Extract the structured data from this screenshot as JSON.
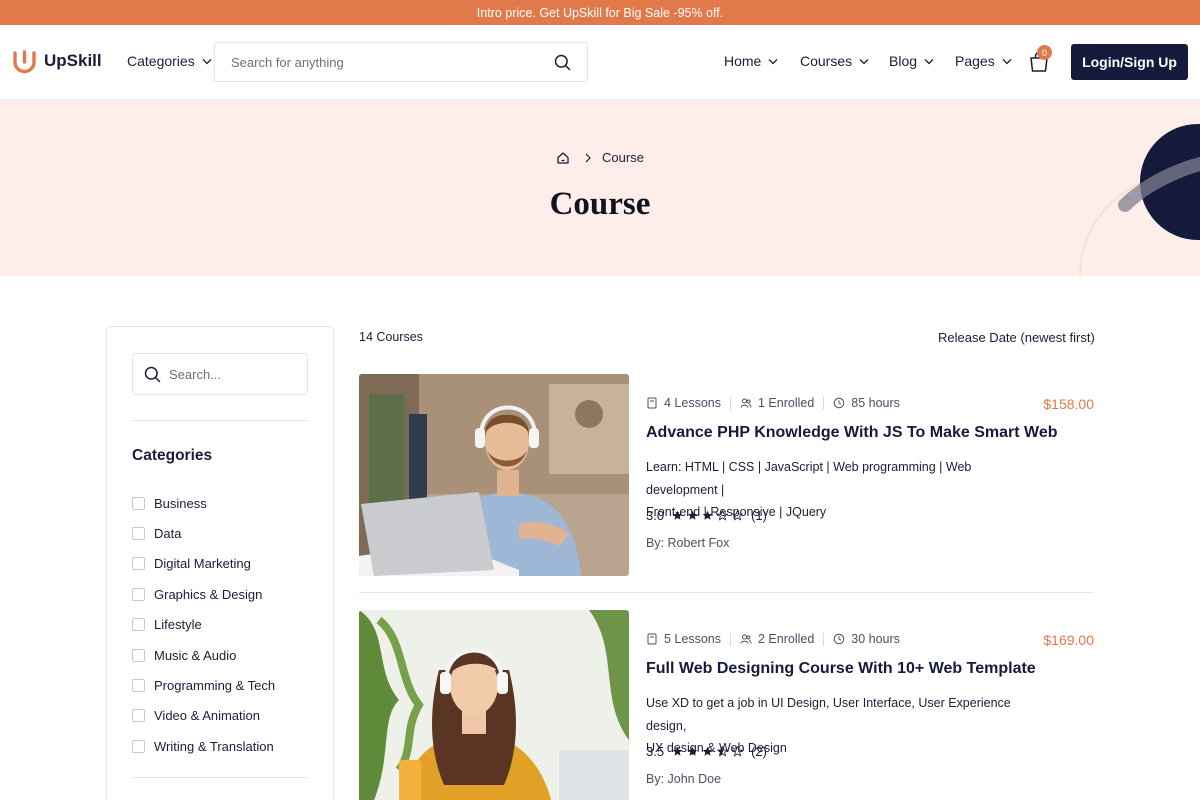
{
  "promo": {
    "text": "Intro price. Get UpSkill for Big Sale -95% off."
  },
  "header": {
    "brand": "UpSkill",
    "categories_label": "Categories",
    "search_placeholder": "Search for anything",
    "nav": [
      {
        "label": "Home"
      },
      {
        "label": "Courses"
      },
      {
        "label": "Blog"
      },
      {
        "label": "Pages"
      }
    ],
    "cart_count": "0",
    "login_label": "Login/Sign Up"
  },
  "hero": {
    "breadcrumb_current": "Course",
    "title": "Course"
  },
  "sidebar": {
    "search_placeholder": "Search...",
    "categories_title": "Categories",
    "categories": [
      {
        "label": "Business"
      },
      {
        "label": "Data"
      },
      {
        "label": "Digital Marketing"
      },
      {
        "label": "Graphics & Design"
      },
      {
        "label": "Lifestyle"
      },
      {
        "label": "Music & Audio"
      },
      {
        "label": "Programming & Tech"
      },
      {
        "label": "Video & Animation"
      },
      {
        "label": "Writing & Translation"
      }
    ]
  },
  "listing": {
    "count_label": "14 Courses",
    "sort_label": "Release Date (newest first)"
  },
  "courses": [
    {
      "lessons": "4 Lessons",
      "enrolled": "1 Enrolled",
      "duration": "85 hours",
      "price": "$158.00",
      "title": "Advance PHP Knowledge With JS To Make Smart Web",
      "desc_line1": "Learn: HTML | CSS | JavaScript | Web programming | Web development |",
      "desc_line2": "Front-end | Responsive | JQuery",
      "rating": "3.0",
      "stars": 3,
      "rating_count": "(1)",
      "author": "By: Robert Fox"
    },
    {
      "lessons": "5 Lessons",
      "enrolled": "2 Enrolled",
      "duration": "30 hours",
      "price": "$169.00",
      "title": "Full Web Designing Course With 10+ Web Template",
      "desc_line1": "Use XD to get a job in UI Design, User Interface, User Experience design,",
      "desc_line2": "UX design & Web Design",
      "rating": "3.5",
      "stars": 3.5,
      "rating_count": "(2)",
      "author": "By: John Doe"
    }
  ],
  "colors": {
    "accent": "#e2794a",
    "navy": "#161a3d",
    "hero_bg": "#fdeee9"
  }
}
